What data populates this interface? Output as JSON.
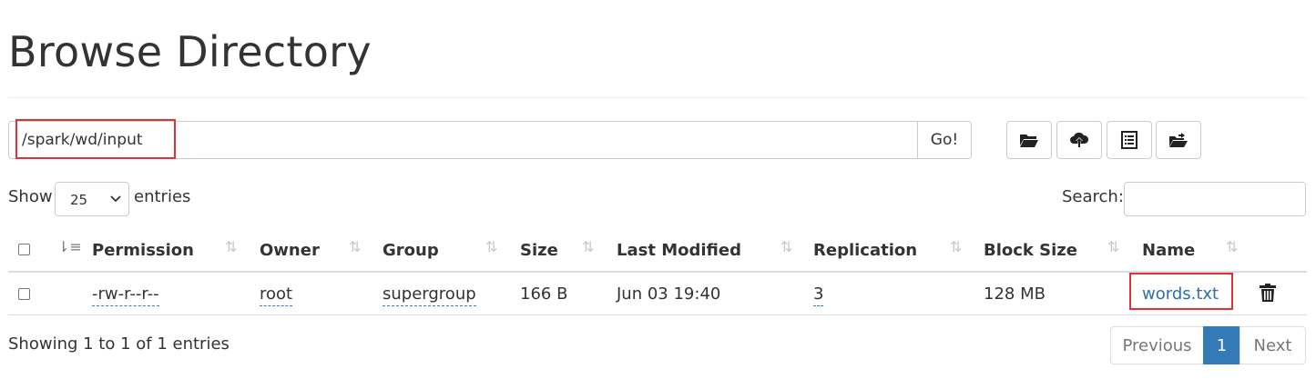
{
  "page": {
    "title": "Browse Directory"
  },
  "path_bar": {
    "value": "/spark/wd/input",
    "go_label": "Go!"
  },
  "toolbar": {
    "buttons": [
      {
        "icon": "folder-open-icon"
      },
      {
        "icon": "cloud-upload-icon"
      },
      {
        "icon": "list-alt-icon"
      },
      {
        "icon": "folder-move-icon"
      }
    ]
  },
  "length_menu": {
    "show_label": "Show",
    "value": "25",
    "entries_label": "entries"
  },
  "search": {
    "label": "Search:",
    "value": ""
  },
  "table": {
    "columns": [
      "Permission",
      "Owner",
      "Group",
      "Size",
      "Last Modified",
      "Replication",
      "Block Size",
      "Name"
    ],
    "rows": [
      {
        "permission": "-rw-r--r--",
        "owner": "root",
        "group": "supergroup",
        "size": "166 B",
        "last_modified": "Jun 03 19:40",
        "replication": "3",
        "block_size": "128 MB",
        "name": "words.txt"
      }
    ]
  },
  "info": "Showing 1 to 1 of 1 entries",
  "pagination": {
    "previous": "Previous",
    "current": "1",
    "next": "Next"
  },
  "colors": {
    "link": "#2a6fb0",
    "active_page": "#337ab7",
    "highlight": "#e0303a"
  }
}
